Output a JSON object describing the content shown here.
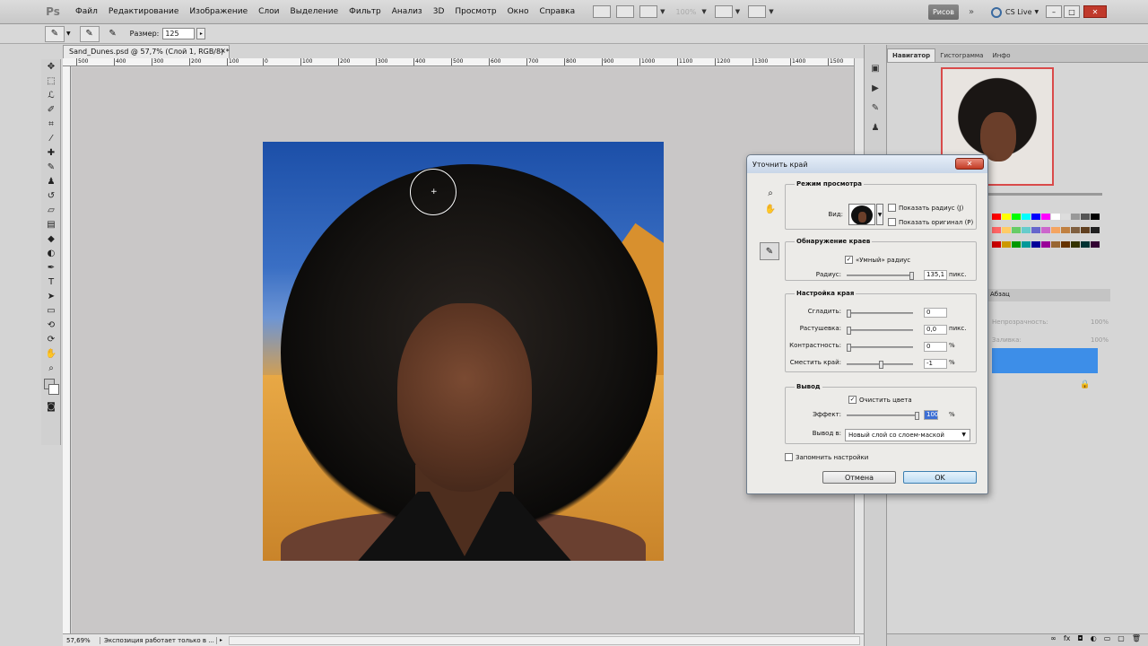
{
  "menubar": {
    "logo": "Ps",
    "items": [
      "Файл",
      "Редактирование",
      "Изображение",
      "Слои",
      "Выделение",
      "Фильтр",
      "Анализ",
      "3D",
      "Просмотр",
      "Окно",
      "Справка"
    ],
    "zoom": "100%",
    "preset": "Рисов",
    "expand": "»",
    "cslive": "CS Live",
    "win_min": "–",
    "win_max": "□",
    "win_close": "✕"
  },
  "options": {
    "size_label": "Размер:",
    "size_value": "125"
  },
  "document": {
    "tab_title": "Sand_Dunes.psd @ 57,7% (Слой 1, RGB/8) *",
    "tab_close": "×",
    "ruler_labels": [
      "500",
      "400",
      "300",
      "200",
      "100",
      "0",
      "100",
      "200",
      "300",
      "400",
      "500",
      "600",
      "700",
      "800",
      "900",
      "1000",
      "1100",
      "1200",
      "1300",
      "1400",
      "1500"
    ]
  },
  "status": {
    "zoom": "57,69%",
    "text": "Экспозиция работает только в ..."
  },
  "right_panel": {
    "tabs": [
      "Навигатор",
      "Гистограмма",
      "Инфо"
    ],
    "layers_tab": "Абзац",
    "opacity_label": "Непрозрачность:",
    "opacity_value": "100%",
    "fill_label": "Заливка:",
    "fill_value": "100%"
  },
  "dialog": {
    "title": "Уточнить край",
    "close": "✕",
    "view_mode": {
      "legend": "Режим просмотра",
      "view_label": "Вид:",
      "show_radius": "Показать радиус (J)",
      "show_original": "Показать оригинал (P)"
    },
    "edge_detection": {
      "legend": "Обнаружение краев",
      "smart_radius": "«Умный» радиус",
      "radius_label": "Радиус:",
      "radius_value": "135,1",
      "radius_unit": "пикс."
    },
    "adjust_edge": {
      "legend": "Настройка края",
      "smooth_label": "Сгладить:",
      "smooth_value": "0",
      "feather_label": "Растушевка:",
      "feather_value": "0,0",
      "feather_unit": "пикс.",
      "contrast_label": "Контрастность:",
      "contrast_value": "0",
      "contrast_unit": "%",
      "shift_label": "Сместить край:",
      "shift_value": "-1",
      "shift_unit": "%"
    },
    "output": {
      "legend": "Вывод",
      "decontaminate": "Очистить цвета",
      "amount_label": "Эффект:",
      "amount_value": "100",
      "amount_unit": "%",
      "output_to_label": "Вывод в:",
      "output_to_value": "Новый слой со слоем-маской"
    },
    "remember": "Запомнить настройки",
    "cancel": "Отмена",
    "ok": "OK"
  },
  "colors": {
    "accent": "#3d8ee8",
    "nav_frame": "#d94a4a",
    "dialog_close": "#c23a24"
  },
  "swatches": [
    "#ff0000",
    "#ffff00",
    "#00ff00",
    "#00ffff",
    "#0000ff",
    "#ff00ff",
    "#ffffff",
    "#dddddd",
    "#999999",
    "#555555",
    "#000000",
    "#ff6666",
    "#ffcc66",
    "#66cc66",
    "#66cccc",
    "#6666cc",
    "#cc66cc",
    "#f4a460",
    "#c08040",
    "#806040",
    "#604020",
    "#202020",
    "#cc0000",
    "#cc9900",
    "#009900",
    "#009999",
    "#000099",
    "#990099",
    "#996633",
    "#663300",
    "#333300",
    "#003333",
    "#330033"
  ]
}
